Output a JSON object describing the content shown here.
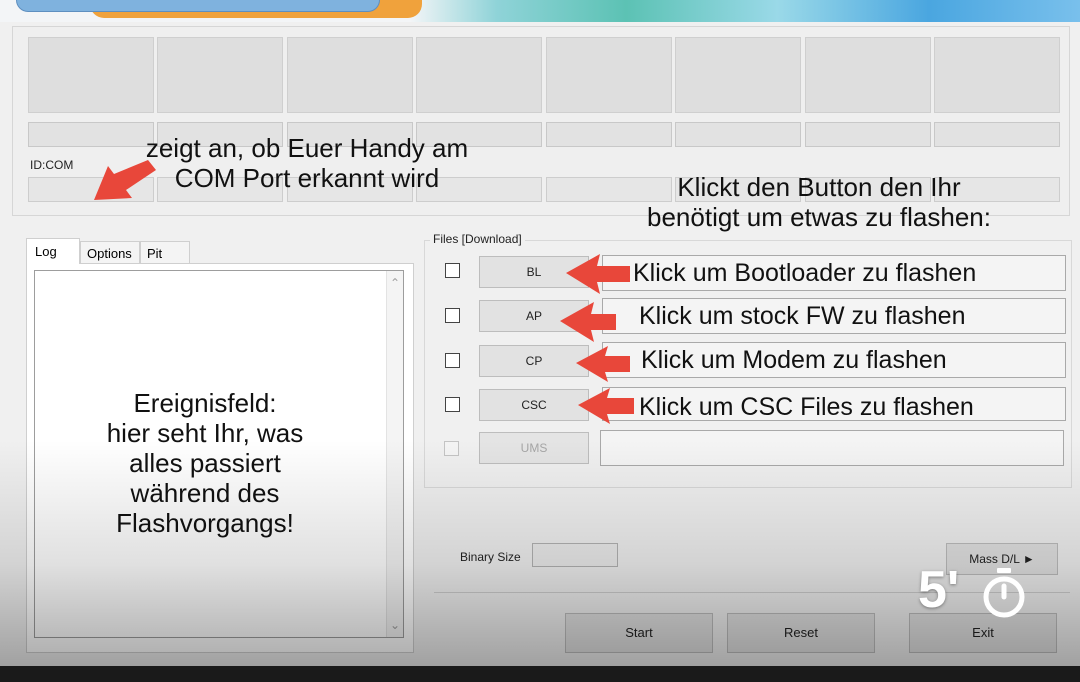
{
  "slots": {
    "id_com_label": "ID:COM"
  },
  "annotations": {
    "com_port_line1": "zeigt an, ob Euer Handy am",
    "com_port_line2": "COM Port erkannt wird",
    "button_hint_line1": "Klickt den Button den Ihr",
    "button_hint_line2": "benötigt um etwas zu flashen:",
    "log_line1": "Ereignisfeld:",
    "log_line2": "hier seht Ihr, was",
    "log_line3": "alles passiert",
    "log_line4": "während des",
    "log_line5": "Flashvorgangs!"
  },
  "tabs": [
    {
      "label": "Log"
    },
    {
      "label": "Options"
    },
    {
      "label": "Pit"
    }
  ],
  "files": {
    "legend": "Files [Download]",
    "rows": [
      {
        "button": "BL",
        "field": "Klick um Bootloader zu flashen"
      },
      {
        "button": "AP",
        "field": "Klick um stock FW zu flashen"
      },
      {
        "button": "CP",
        "field": "Klick um Modem zu flashen"
      },
      {
        "button": "CSC",
        "field": "Klick um CSC Files zu flashen"
      },
      {
        "button": "UMS",
        "field": ""
      }
    ]
  },
  "controls": {
    "binary_size_label": "Binary Size",
    "mass_dl": "Mass D/L ►",
    "start": "Start",
    "reset": "Reset",
    "exit": "Exit"
  },
  "overlay": {
    "duration": "5'",
    "timer_icon": "stopwatch-icon"
  },
  "colors": {
    "arrow": "#e8473a",
    "window_bg": "#f0f0f0"
  }
}
